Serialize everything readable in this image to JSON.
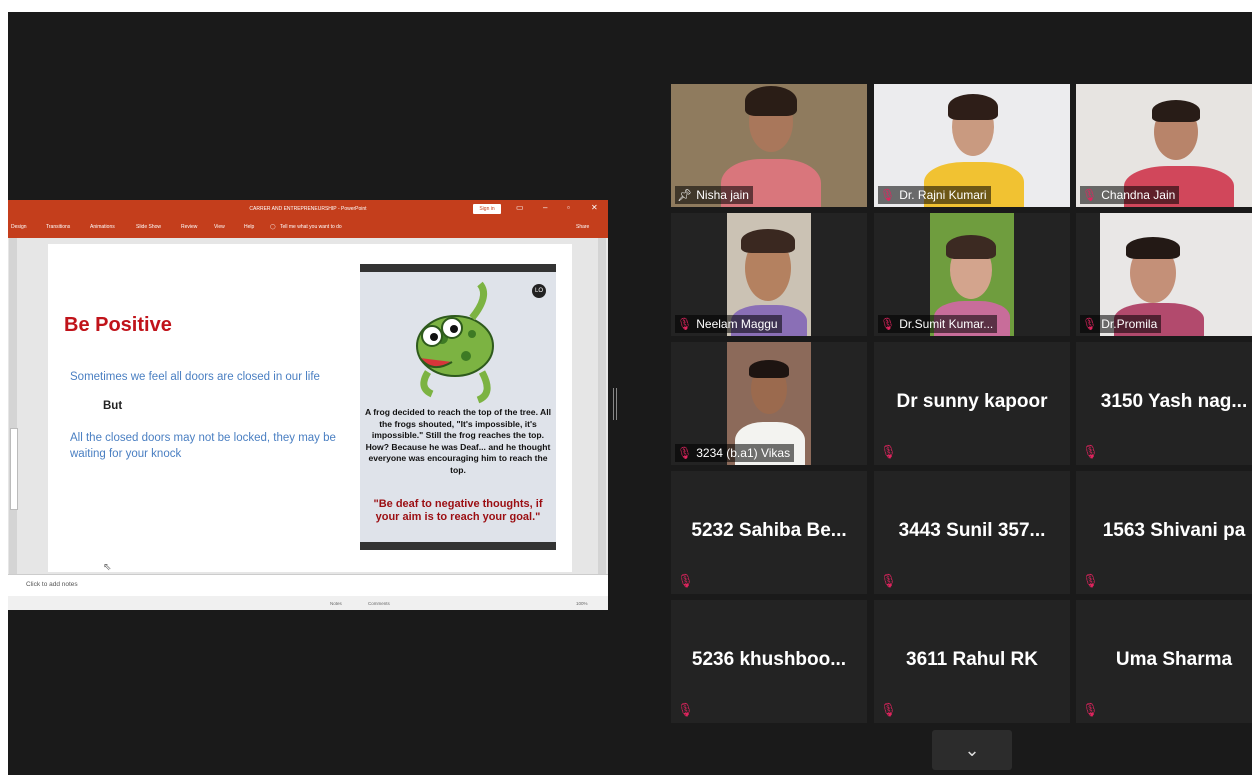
{
  "ppt": {
    "title": "CARRER AND ENTREPRENEURSHIP - PowerPoint",
    "signin": "Sign in",
    "tabs": [
      "Design",
      "Transitions",
      "Animations",
      "Slide Show",
      "Review",
      "View",
      "Help"
    ],
    "tellme": "Tell me what you want to do",
    "share": "Share",
    "notes_placeholder": "Click to add notes",
    "status_notes": "Notes",
    "status_comments": "Comments",
    "zoom": "100%"
  },
  "slide": {
    "title": "Be Positive",
    "line1": "Sometimes we feel all doors are closed in our life",
    "but": "But",
    "line2": "All the closed doors may not be locked, they may be waiting for your knock",
    "poster_story": "A frog decided to reach the top of the tree. All the frogs shouted, \"It's impossible, it's impossible.\" Still the frog reaches the top. How? Because he was Deaf... and he thought everyone was encouraging him to reach the top.",
    "poster_quote": "\"Be deaf to negative thoughts, if your aim is to reach your goal.\"",
    "poster_badge": "LO"
  },
  "participants": [
    {
      "name": "Nisha jain",
      "pinned": true
    },
    {
      "name": "Dr. Rajni Kumari"
    },
    {
      "name": "Chandna Jain"
    },
    {
      "name": "Neelam Maggu"
    },
    {
      "name": "Dr.Sumit Kumar..."
    },
    {
      "name": "Dr.Promila"
    },
    {
      "name": "3234 (b.a1) Vikas"
    },
    {
      "name": "Dr sunny kapoor"
    },
    {
      "name": "3150 Yash  nag..."
    },
    {
      "name": "5232  Sahiba Be..."
    },
    {
      "name": "3443 Sunil  357..."
    },
    {
      "name": "1563 Shivani pa"
    },
    {
      "name": "5236  khushboo..."
    },
    {
      "name": "3611 Rahul RK"
    },
    {
      "name": "Uma Sharma"
    }
  ],
  "icons": {
    "mic_muted": "mic-muted-icon",
    "pin": "pin-icon",
    "chevron": "chevron-down-icon"
  },
  "colors": {
    "active_speaker": "#b5d92b",
    "ppt_brand": "#c43e1c",
    "mute": "#e0245e"
  }
}
